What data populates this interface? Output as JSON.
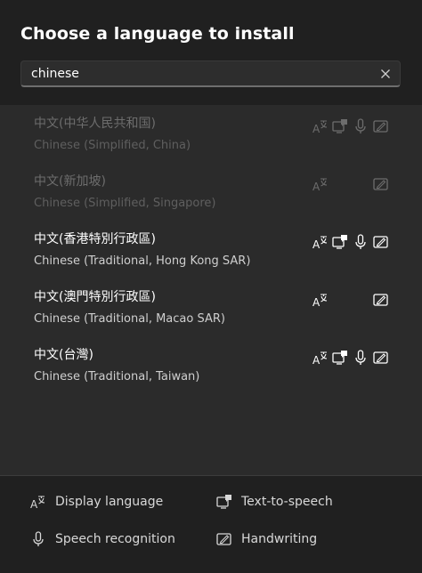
{
  "dialog": {
    "title": "Choose a language to install"
  },
  "search": {
    "value": "chinese",
    "clear_icon": "close-icon"
  },
  "languages": [
    {
      "native": "中文(中华人民共和国)",
      "english": "Chinese (Simplified, China)",
      "state": "disabled",
      "features": [
        "display-language",
        "text-to-speech",
        "speech-recognition",
        "handwriting"
      ]
    },
    {
      "native": "中文(新加坡)",
      "english": "Chinese (Simplified, Singapore)",
      "state": "disabled",
      "features": [
        "display-language",
        "handwriting"
      ]
    },
    {
      "native": "中文(香港特別行政區)",
      "english": "Chinese (Traditional, Hong Kong SAR)",
      "state": "enabled",
      "features": [
        "display-language",
        "text-to-speech",
        "speech-recognition",
        "handwriting"
      ]
    },
    {
      "native": "中文(澳門特別行政區)",
      "english": "Chinese (Traditional, Macao SAR)",
      "state": "enabled",
      "features": [
        "display-language",
        "handwriting"
      ]
    },
    {
      "native": "中文(台灣)",
      "english": "Chinese (Traditional, Taiwan)",
      "state": "enabled",
      "features": [
        "display-language",
        "text-to-speech",
        "speech-recognition",
        "handwriting"
      ]
    }
  ],
  "legend": {
    "display_language": "Display language",
    "text_to_speech": "Text-to-speech",
    "speech_recognition": "Speech recognition",
    "handwriting": "Handwriting"
  },
  "colors": {
    "background": "#202020",
    "list_background": "#2b2b2b",
    "text": "#ffffff",
    "disabled_text": "#6d6d6d"
  }
}
